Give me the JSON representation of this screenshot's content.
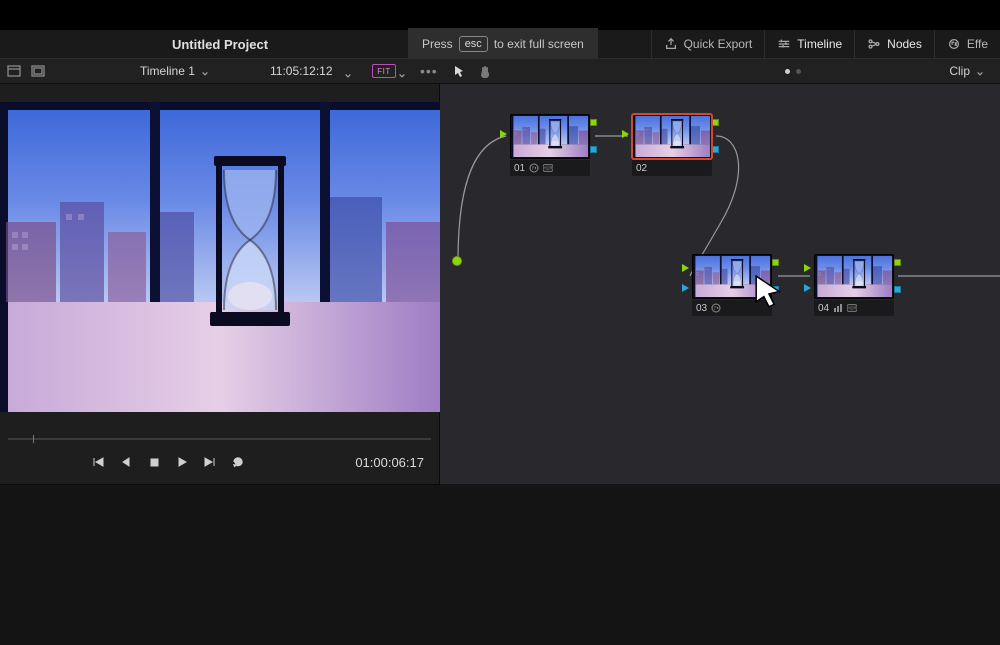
{
  "project": {
    "title": "Untitled Project"
  },
  "fullscreen_hint": {
    "prefix": "Press",
    "key": "esc",
    "suffix": "to exit full screen"
  },
  "top_tools": {
    "quick_export": "Quick Export",
    "timeline": "Timeline",
    "nodes": "Nodes",
    "effects": "Effe"
  },
  "toolbar": {
    "timeline_name": "Timeline 1",
    "record_tc": "11:05:12:12",
    "fit_label": "FIT",
    "clip_label": "Clip"
  },
  "viewer": {
    "play_tc": "01:00:06:17"
  },
  "nodes": [
    {
      "id": "01",
      "label": "01",
      "selected": false,
      "showFx": true,
      "showHdr": true,
      "showBars": false
    },
    {
      "id": "02",
      "label": "02",
      "selected": true,
      "showFx": false,
      "showHdr": false,
      "showBars": false
    },
    {
      "id": "03",
      "label": "03",
      "selected": false,
      "showFx": true,
      "showHdr": false,
      "showBars": false
    },
    {
      "id": "04",
      "label": "04",
      "selected": false,
      "showFx": false,
      "showHdr": true,
      "showBars": true
    }
  ]
}
